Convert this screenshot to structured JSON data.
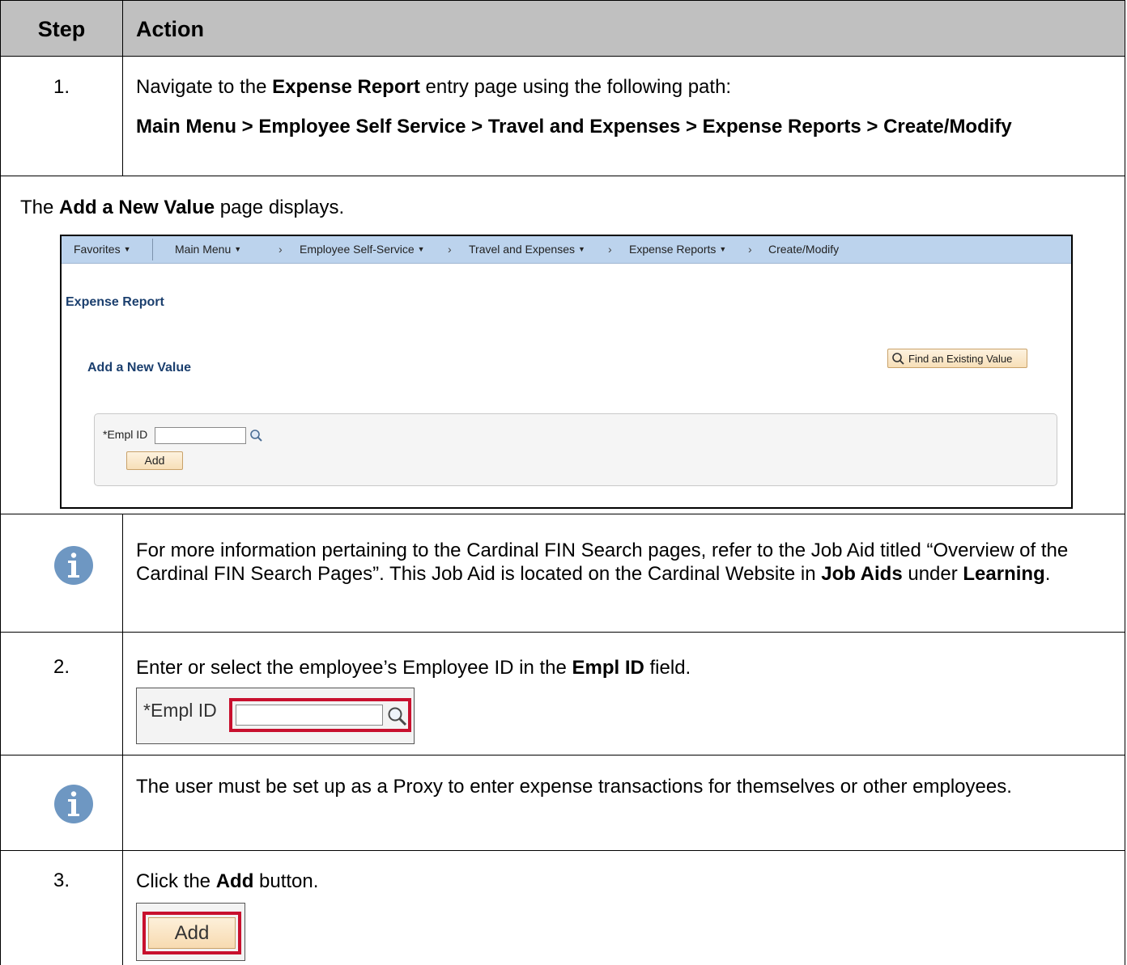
{
  "header": {
    "step": "Step",
    "action": "Action"
  },
  "step1": {
    "num": "1.",
    "p1_pre": "Navigate to the ",
    "p1_bold": "Expense Report",
    "p1_post": " entry page using the following path:",
    "path": "Main Menu > Employee Self Service > Travel and Expenses > Expense Reports > Create/Modify"
  },
  "display_note": {
    "pre": "The ",
    "bold": "Add a New Value",
    "post": " page displays."
  },
  "screenshot": {
    "nav": {
      "favorites": "Favorites",
      "main_menu": "Main Menu",
      "ess": "Employee Self-Service",
      "travel": "Travel and Expenses",
      "expense_reports": "Expense Reports",
      "create_modify": "Create/Modify"
    },
    "page_title": "Expense Report",
    "section_title": "Add a New Value",
    "find_button": "Find an Existing Value",
    "empl_label": "*Empl ID",
    "add_button": "Add"
  },
  "info1": {
    "t1": "For more information pertaining to the Cardinal FIN Search pages, refer to the Job Aid titled “Overview of the Cardinal FIN Search Pages”.  This Job Aid is located on the Cardinal Website in ",
    "b1": "Job Aids",
    "t2": " under ",
    "b2": "Learning",
    "t3": "."
  },
  "step2": {
    "num": "2.",
    "pre": "Enter or select the employee’s Employee ID in the ",
    "bold": "Empl ID",
    "post": " field.",
    "zoom_label": "*Empl ID"
  },
  "info2": {
    "text": "The user must be set up as a Proxy to enter expense transactions for themselves or other employees."
  },
  "step3": {
    "num": "3.",
    "pre": "Click the ",
    "bold": "Add",
    "post": " button.",
    "button": "Add"
  },
  "colors": {
    "header_bg": "#c0c0c0",
    "info_icon": "#6e97c2",
    "highlight": "#c8102e",
    "nav_bg": "#bcd3ed",
    "title_blue": "#1b3f6e"
  }
}
